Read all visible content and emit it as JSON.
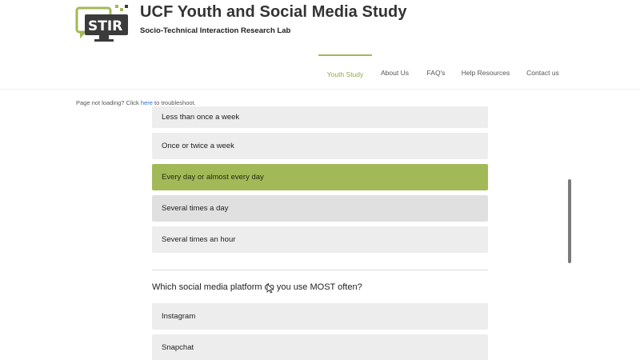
{
  "header": {
    "logo_text": "STIR",
    "title": "UCF Youth and Social Media Study",
    "subtitle": "Socio-Technical Interaction Research Lab",
    "brand_color": "#a2b958"
  },
  "nav": {
    "items": [
      {
        "label": "Youth Study",
        "active": true
      },
      {
        "label": "About Us",
        "active": false
      },
      {
        "label": "FAQ's",
        "active": false
      },
      {
        "label": "Help Resources",
        "active": false
      },
      {
        "label": "Contact us",
        "active": false
      }
    ]
  },
  "notice": {
    "prefix": "Page not loading? Click",
    "link": "here",
    "suffix": "to troubleshoot."
  },
  "frequency_question": {
    "options": [
      {
        "label": "Less than once a week",
        "selected": false
      },
      {
        "label": "Once or twice a week",
        "selected": false
      },
      {
        "label": "Every day or almost every day",
        "selected": true
      },
      {
        "label": "Several times a day",
        "selected": false
      },
      {
        "label": "Several times an hour",
        "selected": false
      }
    ]
  },
  "platform_question": {
    "text": "Which social media platform do you use MOST often?",
    "options": [
      {
        "label": "Instagram",
        "selected": false
      },
      {
        "label": "Snapchat",
        "selected": false
      }
    ]
  }
}
